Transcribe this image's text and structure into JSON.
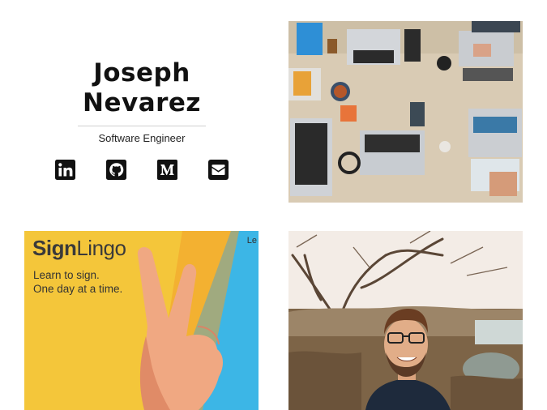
{
  "profile": {
    "first_name": "Joseph",
    "last_name": "Nevarez",
    "title": "Software Engineer"
  },
  "social": [
    {
      "icon": "linkedin-icon"
    },
    {
      "icon": "github-icon"
    },
    {
      "icon": "medium-icon"
    },
    {
      "icon": "envelope-icon"
    }
  ],
  "projects": {
    "signlingo": {
      "logo_bold": "Sign",
      "logo_light": "Lingo",
      "tagline_1": "Learn to sign.",
      "tagline_2": "One day at a time.",
      "corner_text": "Le"
    }
  },
  "colors": {
    "text": "#111111",
    "signlingo_yellow": "#f4c63a",
    "signlingo_blue": "#3cb6e6"
  }
}
